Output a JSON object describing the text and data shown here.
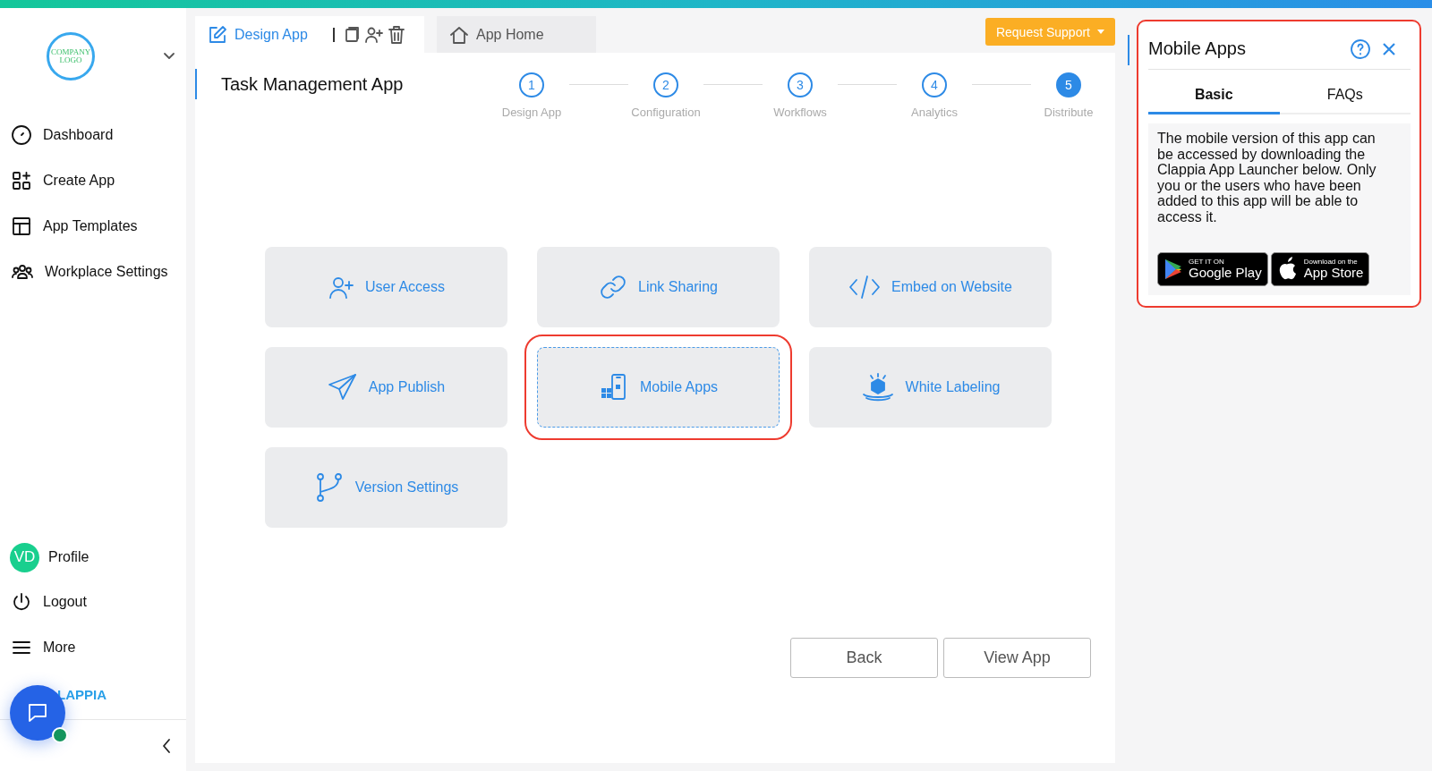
{
  "sidebar": {
    "logo_text": "COMPANY LOGO",
    "items": [
      {
        "label": "Dashboard",
        "kind": "dashboard"
      },
      {
        "label": "Create App",
        "kind": "create"
      },
      {
        "label": "App Templates",
        "kind": "templates"
      },
      {
        "label": "Workplace Settings",
        "kind": "workplace"
      }
    ],
    "profile": {
      "initials": "VD",
      "label": "Profile"
    },
    "bottom_items": [
      {
        "label": "Logout",
        "kind": "logout"
      },
      {
        "label": "More",
        "kind": "more"
      }
    ],
    "brand": "LAPPIA"
  },
  "tabs": [
    {
      "label": "Design App",
      "kind": "design",
      "selected": true
    },
    {
      "label": "App Home",
      "kind": "home",
      "selected": false
    }
  ],
  "request_support": "Request Support",
  "app_title": "Task Management App",
  "steps": [
    {
      "number": "1",
      "label": "Design App",
      "selected": false
    },
    {
      "number": "2",
      "label": "Configuration",
      "selected": false
    },
    {
      "number": "3",
      "label": "Workflows",
      "selected": false
    },
    {
      "number": "4",
      "label": "Analytics",
      "selected": false
    },
    {
      "number": "5",
      "label": "Distribute",
      "selected": true
    }
  ],
  "options": [
    {
      "label": "User Access",
      "kind": "user",
      "selected": false
    },
    {
      "label": "Link Sharing",
      "kind": "link",
      "selected": false
    },
    {
      "label": "Embed on Website",
      "kind": "embed",
      "selected": false
    },
    {
      "label": "App Publish",
      "kind": "publish",
      "selected": false
    },
    {
      "label": "Mobile Apps",
      "kind": "mobile",
      "selected": true
    },
    {
      "label": "White Labeling",
      "kind": "label",
      "selected": false
    },
    {
      "label": "Version Settings",
      "kind": "version",
      "selected": false
    }
  ],
  "buttons": [
    "Back",
    "View App"
  ],
  "panel": {
    "title": "Mobile Apps",
    "tabs": [
      {
        "label": "Basic",
        "selected": true
      },
      {
        "label": "FAQs",
        "selected": false
      }
    ],
    "body": "The mobile version of this app can be accessed by downloading the Clappia App Launcher below. Only you or the users who have been added to this app will be able to access it.",
    "badges": [
      {
        "kind": "google",
        "small": "GET IT ON",
        "big": "Google Play"
      },
      {
        "kind": "apple",
        "small": "Download on the",
        "big": "App Store"
      }
    ]
  }
}
